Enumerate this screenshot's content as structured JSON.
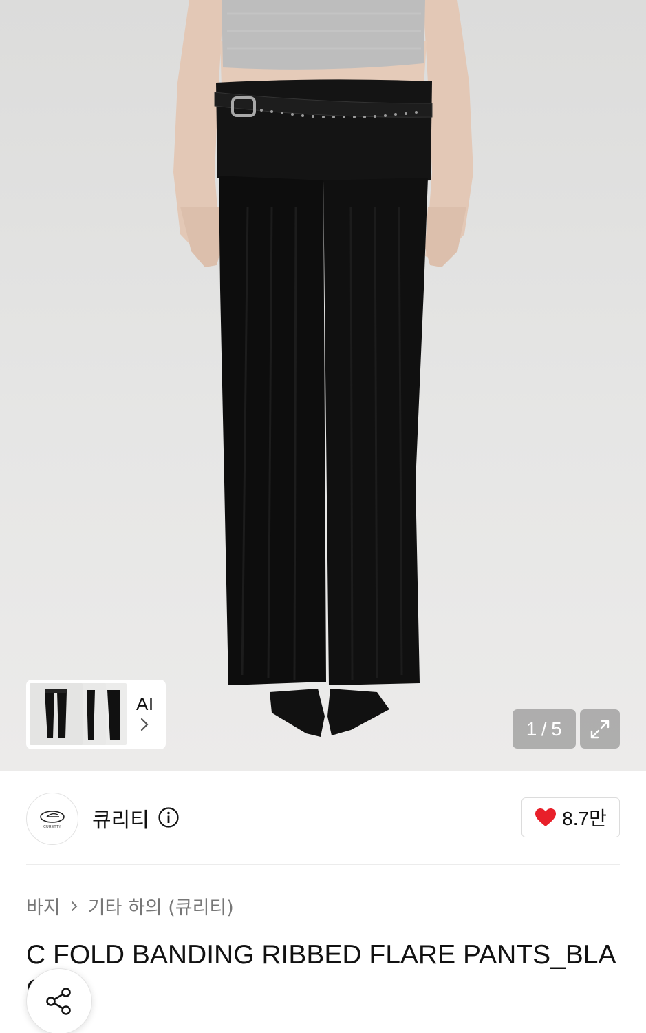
{
  "gallery": {
    "counter_current": "1",
    "counter_sep": "/",
    "counter_total": "5",
    "ai_label": "AI"
  },
  "brand": {
    "name": "큐리티",
    "logo_text": "CURETTY",
    "like_count": "8.7만",
    "like_color": "#e8202a"
  },
  "breadcrumb": {
    "level1": "바지",
    "level2": "기타 하의 (큐리티)"
  },
  "product": {
    "title": "C FOLD BANDING RIBBED FLARE PANTS_BLACK"
  },
  "icons": {
    "info": "info-circle-icon",
    "heart": "heart-icon",
    "expand": "expand-arrows-icon",
    "chevron": "chevron-right-icon",
    "share": "share-icon"
  }
}
